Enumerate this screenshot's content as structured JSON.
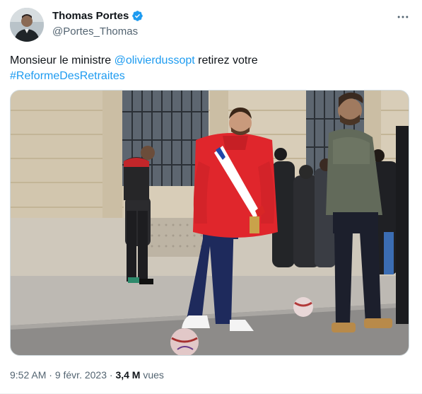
{
  "author": {
    "display_name": "Thomas Portes",
    "handle": "@Portes_Thomas",
    "verified": true,
    "verified_icon": "verified-badge-icon",
    "avatar_icon": "avatar-photo"
  },
  "tweet": {
    "text_prefix": "Monsieur le ministre ",
    "mention": "@olivierdussopt",
    "text_middle": " retirez votre",
    "hashtag": "#ReformeDesRetraites",
    "link_color": "#1d9bf0"
  },
  "media": {
    "icon": "photo-street-scene"
  },
  "meta": {
    "time": "9:52 AM",
    "separator": " · ",
    "date": "9 févr. 2023",
    "views_count": "3,4 M",
    "views_label": " vues"
  },
  "menu": {
    "icon": "more-options-icon"
  }
}
